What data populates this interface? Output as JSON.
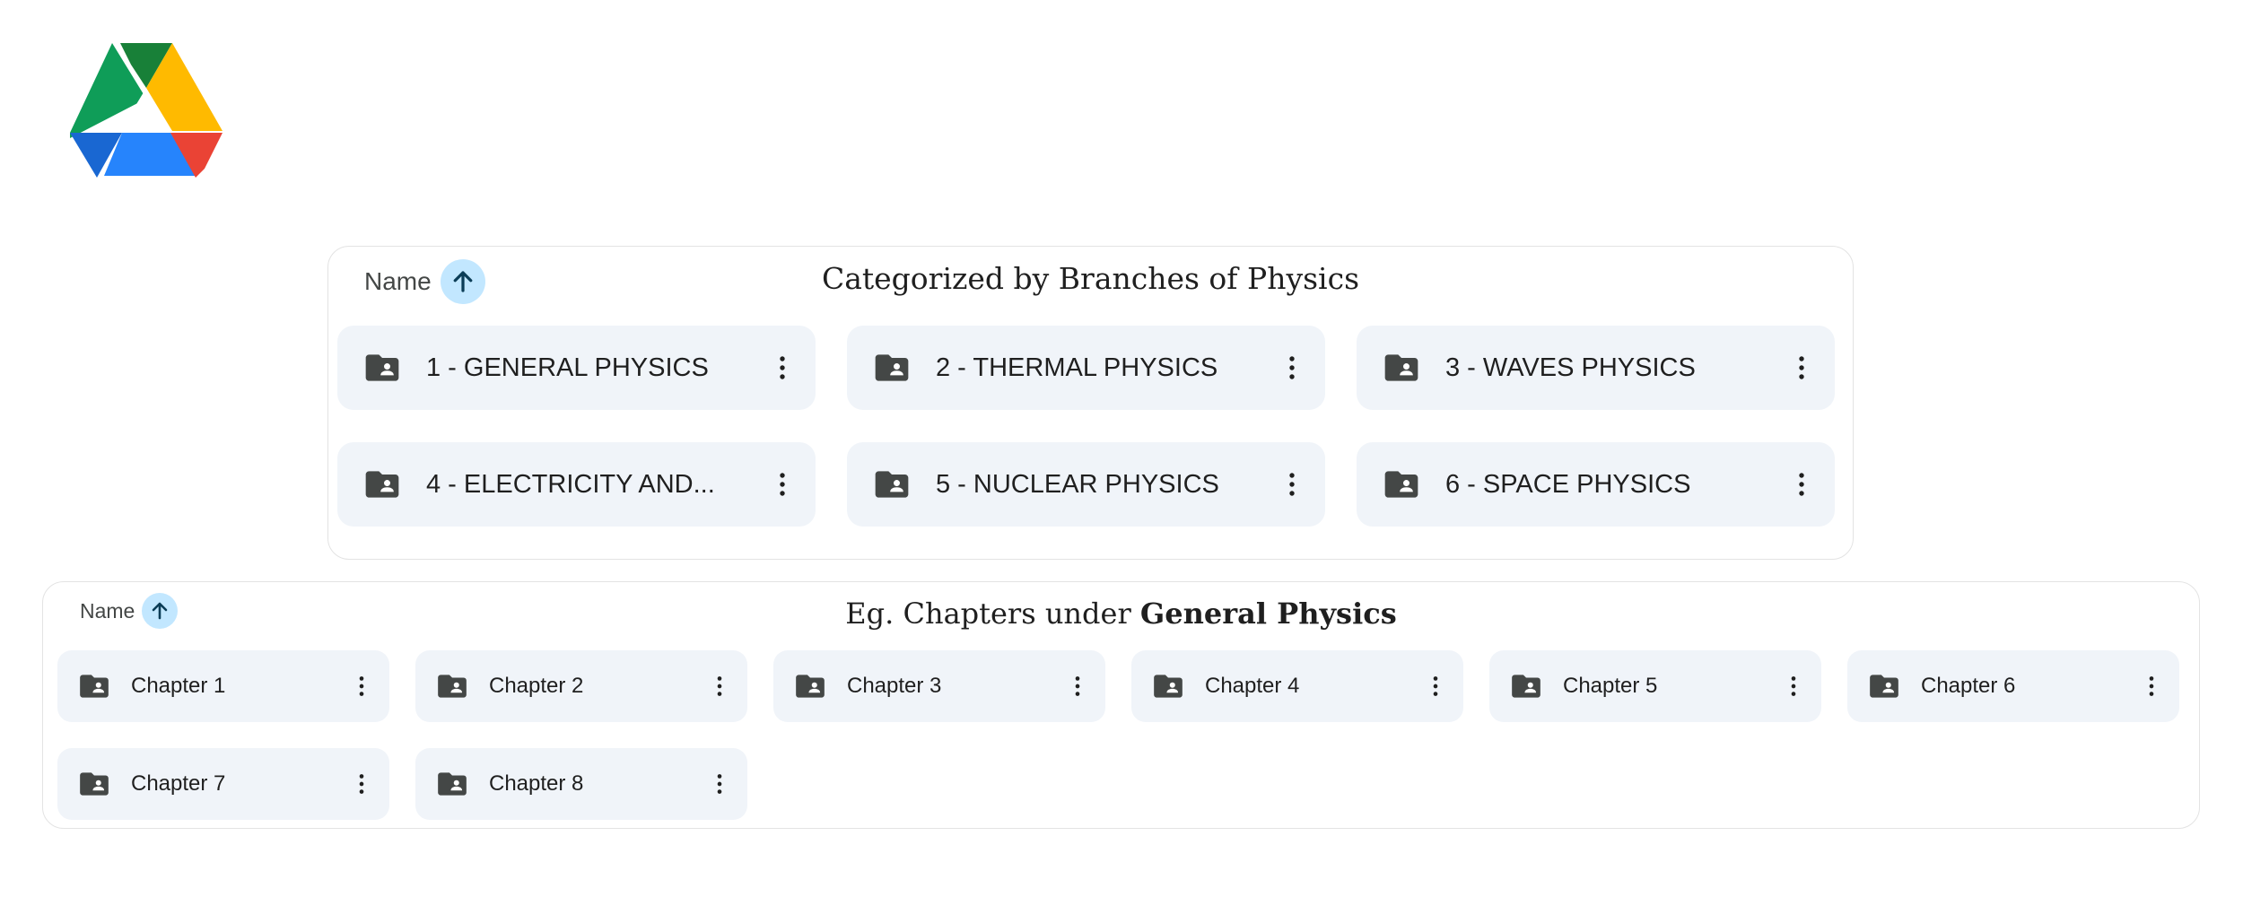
{
  "logo": {
    "name": "google-drive-logo",
    "colors": [
      "#0f9d58",
      "#ffba00",
      "#1f7ae0",
      "#2684fc",
      "#ea4335",
      "#188038"
    ]
  },
  "branches": {
    "sort_label": "Name",
    "title": "Categorized by Branches of Physics",
    "folders": [
      {
        "name": "1 - GENERAL PHYSICS"
      },
      {
        "name": "2 - THERMAL PHYSICS"
      },
      {
        "name": "3 - WAVES PHYSICS"
      },
      {
        "name": "4 - ELECTRICITY AND..."
      },
      {
        "name": "5 - NUCLEAR PHYSICS"
      },
      {
        "name": "6 - SPACE PHYSICS"
      }
    ]
  },
  "chapters": {
    "sort_label": "Name",
    "title_prefix": "Eg. Chapters under",
    "title_bold": "General Physics",
    "folders": [
      {
        "name": "Chapter 1"
      },
      {
        "name": "Chapter 2"
      },
      {
        "name": "Chapter 3"
      },
      {
        "name": "Chapter 4"
      },
      {
        "name": "Chapter 5"
      },
      {
        "name": "Chapter 6"
      },
      {
        "name": "Chapter 7"
      },
      {
        "name": "Chapter 8"
      }
    ]
  },
  "icons": {
    "sort": "arrow-up-icon",
    "folder": "shared-folder-icon",
    "menu": "more-vert-icon"
  },
  "colors": {
    "card_background": "#f0f4f9",
    "sort_button": "#c2e7ff",
    "icon": "#444746"
  }
}
